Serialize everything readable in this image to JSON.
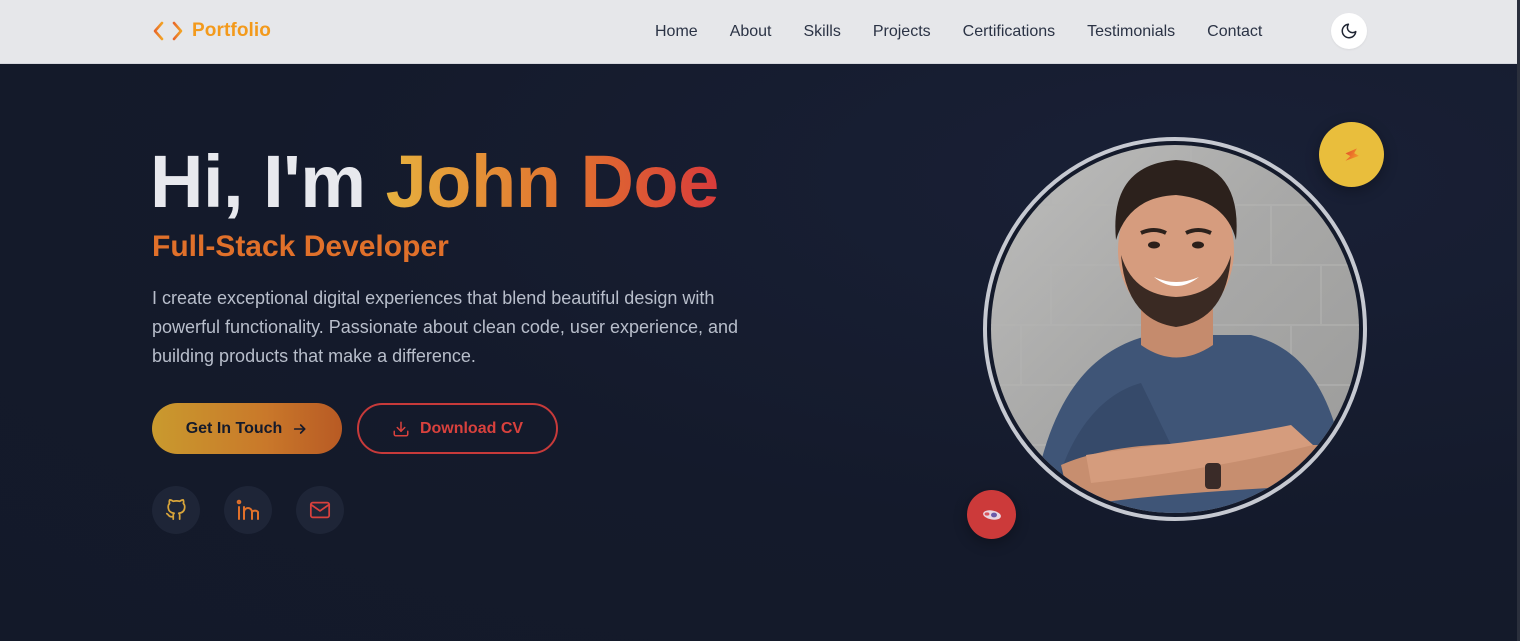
{
  "brand": {
    "name": "Portfolio",
    "icon": "code-brackets-icon"
  },
  "nav": {
    "links": [
      "Home",
      "About",
      "Skills",
      "Projects",
      "Certifications",
      "Testimonials",
      "Contact"
    ],
    "theme_toggle_icon": "moon-icon"
  },
  "hero": {
    "greeting": "Hi, I'm ",
    "name": "John Doe",
    "role": "Full-Stack Developer",
    "bio": "I create exceptional digital experiences that blend beautiful design with powerful functionality. Passionate about clean code, user experience, and building products that make a difference.",
    "primary_button": {
      "label": "Get In Touch",
      "icon": "arrow-right-icon"
    },
    "secondary_button": {
      "label": "Download CV",
      "icon": "download-icon"
    },
    "socials": [
      {
        "name": "github",
        "icon": "github-icon"
      },
      {
        "name": "linkedin",
        "icon": "linkedin-icon"
      },
      {
        "name": "email",
        "icon": "mail-icon"
      }
    ],
    "badges": [
      {
        "icon": "lightning-icon",
        "color": "#e9be3c"
      },
      {
        "icon": "sticker-icon",
        "color": "#cc3a3a"
      }
    ]
  },
  "colors": {
    "accent_gold": "#e7b13e",
    "accent_orange": "#e0702a",
    "accent_red": "#d83b3b",
    "background": "#141a2b",
    "navbar": "#e6e7ea"
  }
}
